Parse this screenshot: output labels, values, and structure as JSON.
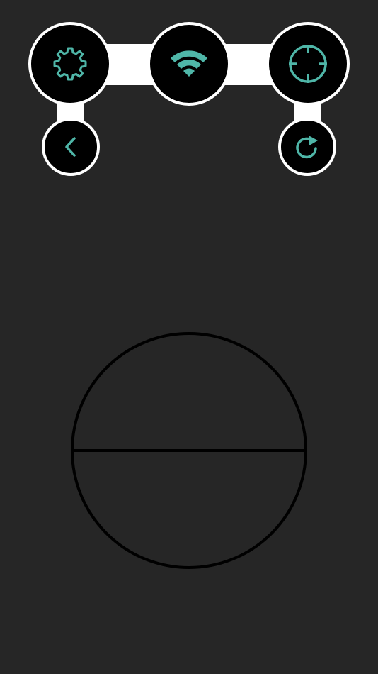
{
  "colors": {
    "background": "#262626",
    "accent": "#4fb6a8",
    "button_fill": "#000000",
    "button_border": "#ffffff",
    "horizon_stroke": "#000000"
  },
  "toolbar": {
    "settings_icon": "gear-icon",
    "wifi_icon": "wifi-icon",
    "target_icon": "crosshair-icon",
    "back_icon": "chevron-left-icon",
    "reset_icon": "refresh-icon"
  },
  "attitude_indicator": {
    "roll_deg": 0,
    "pitch_deg": 0
  }
}
